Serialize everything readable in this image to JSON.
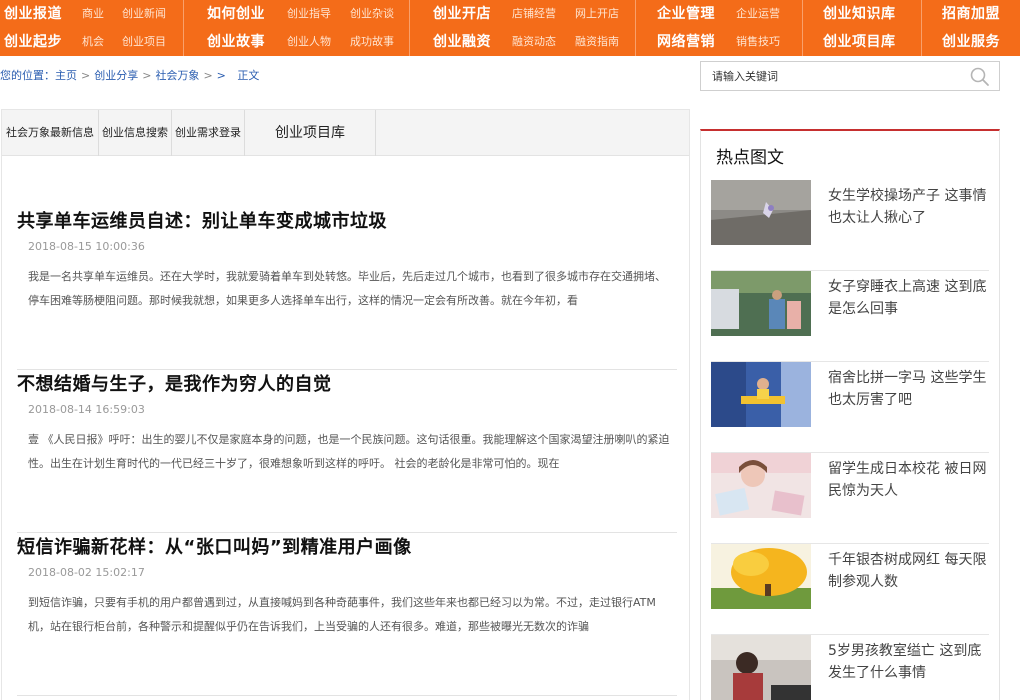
{
  "nav": {
    "groups": [
      {
        "rows": [
          {
            "main": "创业报道",
            "subs": [
              "商业",
              "创业新闻"
            ]
          },
          {
            "main": "创业起步",
            "subs": [
              "机会",
              "创业项目"
            ]
          }
        ]
      },
      {
        "rows": [
          {
            "main": "如何创业",
            "subs": [
              "创业指导",
              "创业杂谈"
            ]
          },
          {
            "main": "创业故事",
            "subs": [
              "创业人物",
              "成功故事"
            ]
          }
        ]
      },
      {
        "rows": [
          {
            "main": "创业开店",
            "subs": [
              "店铺经营",
              "网上开店"
            ]
          },
          {
            "main": "创业融资",
            "subs": [
              "融资动态",
              "融资指南"
            ]
          }
        ]
      },
      {
        "rows": [
          {
            "main": "企业管理",
            "subs": [
              "企业运营"
            ]
          },
          {
            "main": "网络营销",
            "subs": [
              "销售技巧"
            ]
          }
        ]
      },
      {
        "rows": [
          {
            "main": "创业知识库",
            "subs": []
          },
          {
            "main": "创业项目库",
            "subs": []
          }
        ]
      },
      {
        "rows": [
          {
            "main": "招商加盟",
            "subs": []
          },
          {
            "main": "创业服务",
            "subs": []
          }
        ]
      }
    ]
  },
  "breadcrumb": {
    "prefix": "您的位置：",
    "items": [
      "主页",
      "创业分享",
      "社会万象"
    ],
    "extra": ">",
    "current": "正文"
  },
  "search": {
    "placeholder": "请输入关键词"
  },
  "tabs": [
    "社会万象最新信息",
    "创业信息搜索",
    "创业需求登录",
    "创业项目库"
  ],
  "articles": [
    {
      "title": "共享单车运维员自述：别让单车变成城市垃圾",
      "date": "2018-08-15 10:00:36",
      "summary": "我是一名共享单车运维员。还在大学时，我就爱骑着单车到处转悠。毕业后，先后走过几个城市，也看到了很多城市存在交通拥堵、停车困难等肠梗阻问题。那时候我就想，如果更多人选择单车出行，这样的情况一定会有所改善。就在今年初，看"
    },
    {
      "title": "不想结婚与生子，是我作为穷人的自觉",
      "date": "2018-08-14 16:59:03",
      "summary": "壹 《人民日报》呼吁：出生的婴儿不仅是家庭本身的问题，也是一个民族问题。这句话很重。我能理解这个国家渴望注册喇叭的紧迫性。出生在计划生育时代的一代已经三十岁了，很难想象听到这样的呼吁。 社会的老龄化是非常可怕的。现在"
    },
    {
      "title": "短信诈骗新花样：从“张口叫妈”到精准用户画像",
      "date": "2018-08-02 15:02:17",
      "summary": "到短信诈骗，只要有手机的用户都曾遇到过，从直接喊妈到各种奇葩事件，我们这些年来也都已经习以为常。不过，走过银行ATM机，站在银行柜台前，各种警示和提醒似乎仍在告诉我们，上当受骗的人还有很多。难道，那些被曝光无数次的诈骗"
    }
  ],
  "sidebar": {
    "title": "热点图文",
    "items": [
      {
        "title": "女生学校操场产子 这事情也太让人揪心了"
      },
      {
        "title": "女子穿睡衣上高速 这到底是怎么回事"
      },
      {
        "title": "宿舍比拼一字马 这些学生也太厉害了吧"
      },
      {
        "title": "留学生成日本校花 被日网民惊为天人"
      },
      {
        "title": "千年银杏树成网红 每天限制参观人数"
      },
      {
        "title": "5岁男孩教室缢亡 这到底发生了什么事情"
      }
    ]
  },
  "colors": {
    "nav_bg": "#f46c19",
    "link": "#2a5db0",
    "sidebar_accent": "#c62f2f"
  }
}
